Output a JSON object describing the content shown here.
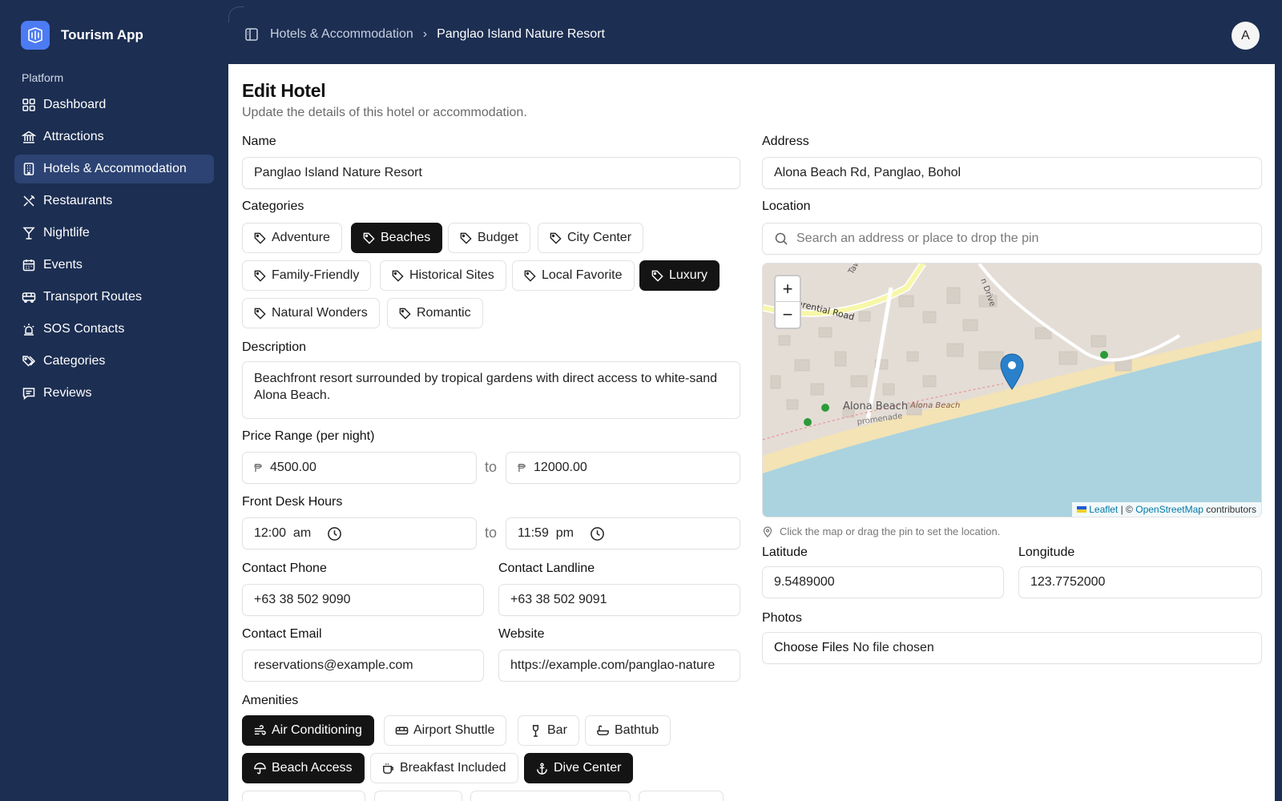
{
  "app": {
    "name": "Tourism App"
  },
  "sidebar": {
    "group": "Platform",
    "items": [
      {
        "label": "Dashboard",
        "icon": "dashboard-icon"
      },
      {
        "label": "Attractions",
        "icon": "landmark-icon"
      },
      {
        "label": "Hotels & Accommodation",
        "icon": "building-icon",
        "active": true
      },
      {
        "label": "Restaurants",
        "icon": "utensils-icon"
      },
      {
        "label": "Nightlife",
        "icon": "martini-icon"
      },
      {
        "label": "Events",
        "icon": "calendar-icon"
      },
      {
        "label": "Transport Routes",
        "icon": "bus-icon"
      },
      {
        "label": "SOS Contacts",
        "icon": "siren-icon"
      },
      {
        "label": "Categories",
        "icon": "tags-icon"
      },
      {
        "label": "Reviews",
        "icon": "message-icon"
      }
    ]
  },
  "breadcrumb": {
    "parent": "Hotels & Accommodation",
    "separator": "›",
    "current": "Panglao Island Nature Resort"
  },
  "user": {
    "avatar_letter": "A"
  },
  "form": {
    "title": "Edit Hotel",
    "subtitle": "Update the details of this hotel or accommodation.",
    "name": {
      "label": "Name",
      "value": "Panglao Island Nature Resort"
    },
    "categories": {
      "label": "Categories",
      "items": [
        {
          "label": "Adventure",
          "selected": false
        },
        {
          "label": "Beaches",
          "selected": true
        },
        {
          "label": "Budget",
          "selected": false
        },
        {
          "label": "City Center",
          "selected": false
        },
        {
          "label": "Family-Friendly",
          "selected": false
        },
        {
          "label": "Historical Sites",
          "selected": false
        },
        {
          "label": "Local Favorite",
          "selected": false
        },
        {
          "label": "Luxury",
          "selected": true
        },
        {
          "label": "Natural Wonders",
          "selected": false
        },
        {
          "label": "Romantic",
          "selected": false
        }
      ]
    },
    "description": {
      "label": "Description",
      "value": "Beachfront resort surrounded by tropical gardens with direct access to white-sand Alona Beach."
    },
    "price": {
      "label": "Price Range (per night)",
      "currency": "₱",
      "min": "4500.00",
      "to": "to",
      "max": "12000.00"
    },
    "hours": {
      "label": "Front Desk Hours",
      "open": "12:00  am",
      "to": "to",
      "close": "11:59  pm"
    },
    "phone": {
      "label": "Contact Phone",
      "value": "+63 38 502 9090"
    },
    "landline": {
      "label": "Contact Landline",
      "value": "+63 38 502 9091"
    },
    "email": {
      "label": "Contact Email",
      "value": "reservations@example.com"
    },
    "website": {
      "label": "Website",
      "value": "https://example.com/panglao-nature"
    },
    "amenities": {
      "label": "Amenities",
      "items": [
        {
          "label": "Air Conditioning",
          "selected": true,
          "icon": "wind-icon"
        },
        {
          "label": "Airport Shuttle",
          "selected": false,
          "icon": "bus-icon"
        },
        {
          "label": "Bar",
          "selected": false,
          "icon": "wine-icon"
        },
        {
          "label": "Bathtub",
          "selected": false,
          "icon": "bath-icon"
        },
        {
          "label": "Beach Access",
          "selected": true,
          "icon": "umbrella-icon"
        },
        {
          "label": "Breakfast Included",
          "selected": false,
          "icon": "coffee-icon"
        },
        {
          "label": "Dive Center",
          "selected": true,
          "icon": "anchor-icon"
        }
      ]
    },
    "address": {
      "label": "Address",
      "value": "Alona Beach Rd, Panglao, Bohol"
    },
    "location": {
      "label": "Location",
      "search_placeholder": "Search an address or place to drop the pin",
      "hint": "Click the map or drag the pin to set the location.",
      "map_labels": {
        "road": "Ferferential Road",
        "place": "Alona Beach",
        "place2": "Alona Beach",
        "promenade": "promenade",
        "drive": "n Drive",
        "tawala": "Tawala"
      },
      "attribution": {
        "leaflet": "Leaflet",
        "sep": "| ©",
        "osm": "OpenStreetMap",
        "suffix": "contributors"
      }
    },
    "latitude": {
      "label": "Latitude",
      "value": "9.5489000"
    },
    "longitude": {
      "label": "Longitude",
      "value": "123.7752000"
    },
    "photos": {
      "label": "Photos",
      "button": "Choose Files",
      "status": "No file chosen"
    }
  },
  "colors": {
    "sidebar_bg": "#1c2e52",
    "active_item": "#2c4373",
    "brand": "#4c7bf3",
    "chip_selected": "#141414",
    "sea": "#aad3df",
    "pin": "#2a81cb"
  }
}
